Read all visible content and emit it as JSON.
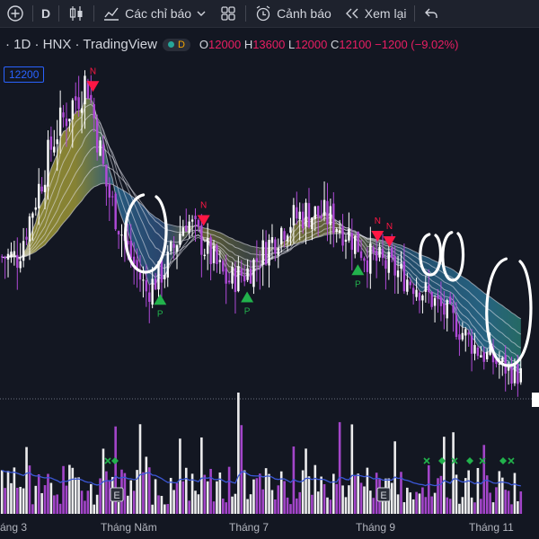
{
  "toolbar": {
    "add_icon": "plus-circle-icon",
    "interval": "D",
    "candles_icon": "candlestick-icon",
    "indicators_label": "Các chỉ báo",
    "indicators_icon": "indicators-icon",
    "templates_icon": "grid-icon",
    "alert_label": "Cảnh báo",
    "alert_icon": "alarm-clock-icon",
    "replay_label": "Xem lại",
    "replay_icon": "rewind-icon",
    "undo_icon": "undo-icon"
  },
  "legend": {
    "symbol_text": "· 1D · HNX · TradingView",
    "badge": "D",
    "o_label": "O",
    "o_value": "12000",
    "h_label": "H",
    "h_value": "13600",
    "l_label": "L",
    "l_value": "12000",
    "c_label": "C",
    "c_value": "12100",
    "change": "−1200 (−9.02%)"
  },
  "price_tag": "12200",
  "colors": {
    "background": "#131722",
    "bull_candle": "#ffffff",
    "bear_candle": "#b04ad8",
    "band_yellow": "#c8c040",
    "band_blue": "#2a6f9a",
    "sell_signal": "#ff1744",
    "buy_signal": "#22b24c",
    "volume_avg": "#3b57d6"
  },
  "chart_data": {
    "type": "candlestick",
    "x_labels": [
      "áng 3",
      "Tháng Năm",
      "Tháng 7",
      "Tháng 9",
      "Tháng 11"
    ],
    "signal_labels": {
      "sell": "N",
      "buy": "P",
      "event": "E"
    },
    "price_path": [
      [
        "2023-03-01",
        12000
      ],
      [
        "2023-03-20",
        14500
      ],
      [
        "2023-04-05",
        15600
      ],
      [
        "2023-04-15",
        13400
      ],
      [
        "2023-04-25",
        12200
      ],
      [
        "2023-05-05",
        11300
      ],
      [
        "2023-05-15",
        11800
      ],
      [
        "2023-05-25",
        12800
      ],
      [
        "2023-06-05",
        12100
      ],
      [
        "2023-06-15",
        11500
      ],
      [
        "2023-06-25",
        11700
      ],
      [
        "2023-07-05",
        12200
      ],
      [
        "2023-07-15",
        12700
      ],
      [
        "2023-07-25",
        12900
      ],
      [
        "2023-08-05",
        12800
      ],
      [
        "2023-08-15",
        12500
      ],
      [
        "2023-08-25",
        12000
      ],
      [
        "2023-09-05",
        11800
      ],
      [
        "2023-09-20",
        11400
      ],
      [
        "2023-10-05",
        10800
      ],
      [
        "2023-10-20",
        10100
      ],
      [
        "2023-11-01",
        9800
      ],
      [
        "2023-11-10",
        9600
      ]
    ],
    "sell_signals": [
      "2023-04-08",
      "2023-06-03",
      "2023-08-30",
      "2023-09-05"
    ],
    "buy_signals": [
      "2023-05-12",
      "2023-06-25",
      "2023-08-20"
    ],
    "last": {
      "open": 12000,
      "high": 13600,
      "low": 12000,
      "close": 12100,
      "change": -1200,
      "change_pct": -9.02
    }
  }
}
